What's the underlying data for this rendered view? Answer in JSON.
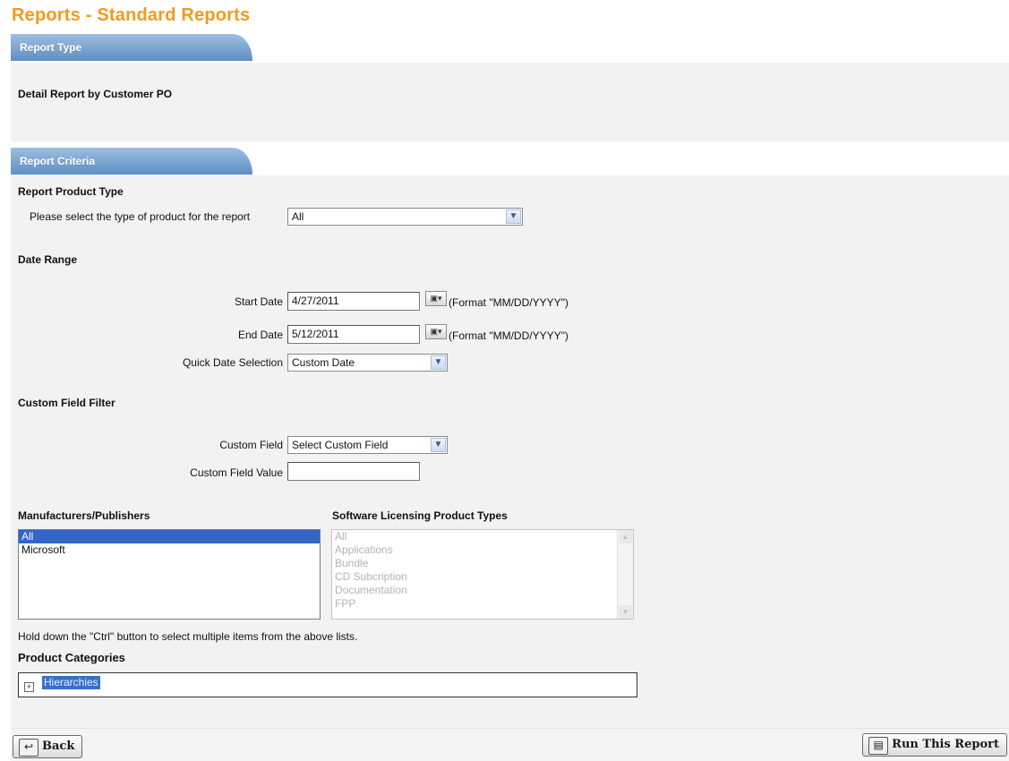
{
  "page": {
    "title": "Reports - Standard Reports"
  },
  "report_type": {
    "tab_label": "Report Type",
    "value": "Detail Report by Customer PO"
  },
  "criteria": {
    "tab_label": "Report Criteria",
    "product_type": {
      "heading": "Report Product Type",
      "prompt": "Please select the type of product for the report",
      "selected": "All"
    },
    "date_range": {
      "heading": "Date Range",
      "start_label": "Start Date",
      "start_value": "4/27/2011",
      "end_label": "End Date",
      "end_value": "5/12/2011",
      "format_hint": "(Format \"MM/DD/YYYY\")",
      "quick_label": "Quick Date Selection",
      "quick_selected": "Custom Date"
    },
    "custom_field": {
      "heading": "Custom Field Filter",
      "field_label": "Custom Field",
      "field_selected": "Select Custom Field",
      "value_label": "Custom Field Value",
      "value": ""
    },
    "manufacturers": {
      "heading": "Manufacturers/Publishers",
      "options": [
        "All",
        "Microsoft"
      ],
      "selected": "All"
    },
    "software_types": {
      "heading": "Software Licensing Product Types",
      "options": [
        "All",
        "Applications",
        "Bundle",
        "CD Subcription",
        "Documentation",
        "FPP"
      ]
    },
    "multi_select_hint": "Hold down the \"Ctrl\" button to select multiple items from the above lists.",
    "product_categories": {
      "heading": "Product Categories",
      "root_node": "Hierarchies",
      "expander": "+"
    }
  },
  "actions": {
    "back_label": "Back",
    "run_label": "Run This Report"
  },
  "colors": {
    "title": "#f19a1f",
    "tab_gradient_top": "#9cbfdf",
    "tab_gradient_bottom": "#5e8fc3",
    "selection": "#3166c4"
  },
  "icons": {
    "calendar": "calendar-icon",
    "dropdown": "chevron-down-icon",
    "back": "back-icon",
    "run": "run-report-icon"
  }
}
